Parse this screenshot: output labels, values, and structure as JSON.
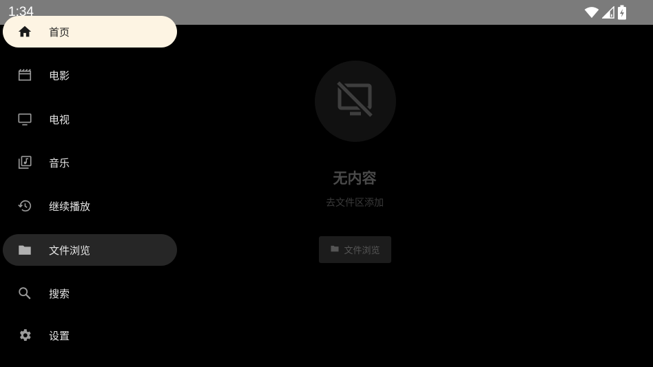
{
  "status_bar": {
    "time": "1:34",
    "icons": [
      "wifi-icon",
      "signal-icon",
      "battery-charging-icon"
    ]
  },
  "sidebar": {
    "items": [
      {
        "label": "首页",
        "icon": "home-icon"
      },
      {
        "label": "电影",
        "icon": "movie-icon"
      },
      {
        "label": "电视",
        "icon": "tv-icon"
      },
      {
        "label": "音乐",
        "icon": "music-library-icon"
      },
      {
        "label": "继续播放",
        "icon": "history-icon"
      },
      {
        "label": "文件浏览",
        "icon": "folder-icon"
      },
      {
        "label": "搜索",
        "icon": "search-icon"
      },
      {
        "label": "设置",
        "icon": "gear-icon"
      }
    ]
  },
  "empty_state": {
    "icon": "no-display-icon",
    "title": "无内容",
    "subtitle": "去文件区添加",
    "button_label": "文件浏览",
    "button_icon": "folder-icon"
  },
  "colors": {
    "status_bar_bg": "#7b7b7b",
    "background": "#000000",
    "home_highlight": "#fdf4e3",
    "focus_highlight": "#262626"
  }
}
